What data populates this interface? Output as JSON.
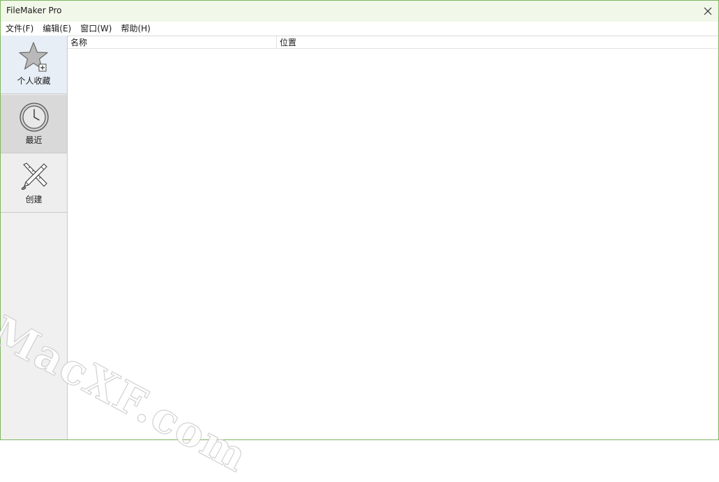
{
  "window": {
    "title": "FileMaker Pro",
    "border_color": "#7fb661",
    "titlebar_color": "#f1f8ea"
  },
  "titlebar": {
    "close_icon": "close-icon"
  },
  "menu": {
    "items": [
      {
        "label": "文件(F)"
      },
      {
        "label": "编辑(E)"
      },
      {
        "label": "窗口(W)"
      },
      {
        "label": "帮助(H)"
      }
    ]
  },
  "sidebar": {
    "items": [
      {
        "label": "个人收藏",
        "icon": "star-add-icon",
        "state": "default"
      },
      {
        "label": "最近",
        "icon": "clock-icon",
        "state": "selected"
      },
      {
        "label": "创建",
        "icon": "pencil-ruler-icon",
        "state": "default"
      }
    ]
  },
  "table": {
    "columns": [
      {
        "label": "名称"
      },
      {
        "label": "位置"
      }
    ],
    "rows": []
  },
  "watermark": {
    "text": "MacXF.com"
  }
}
